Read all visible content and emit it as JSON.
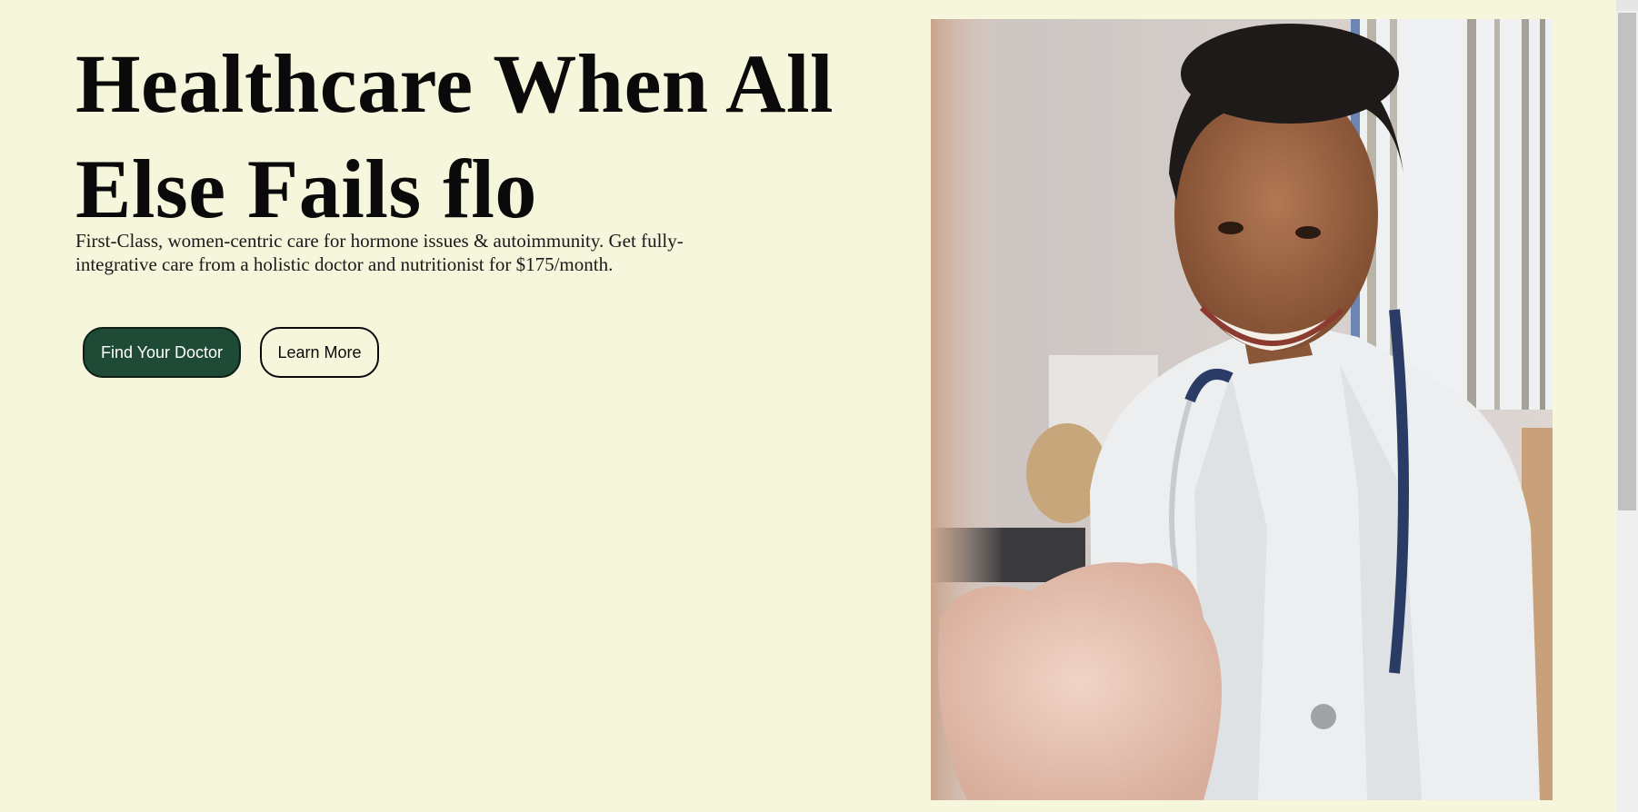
{
  "hero": {
    "title": "Healthcare When All Else Fails flo",
    "subtitle": "First-Class, women-centric care for hormone issues & autoimmunity. Get fully-integrative care from a holistic doctor and nutritionist for $175/month.",
    "primary_button": "Find Your Doctor",
    "secondary_button": "Learn More"
  },
  "colors": {
    "background": "#f6f6dc",
    "primary_button": "#1f4a35",
    "text": "#0a0a0a"
  },
  "image": {
    "subject": "smiling doctor in white coat with stethoscope"
  }
}
